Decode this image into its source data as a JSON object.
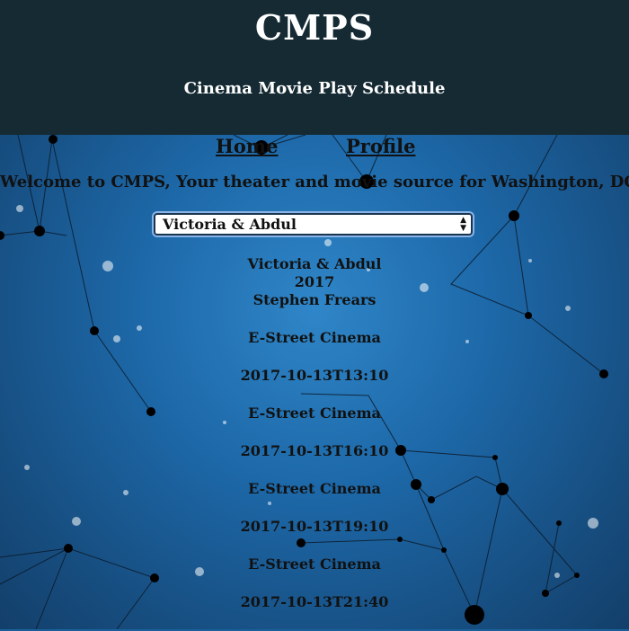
{
  "header": {
    "title": "CMPS",
    "subtitle": "Cinema Movie Play Schedule"
  },
  "nav": {
    "home": "Home",
    "profile": "Profile"
  },
  "welcome": "Welcome to CMPS, Your theater and movie source for Washington, DC!",
  "movie_select": {
    "selected": "Victoria & Abdul"
  },
  "movie": {
    "title": "Victoria & Abdul",
    "year": "2017",
    "director": "Stephen Frears"
  },
  "showings": [
    {
      "theater": "E-Street Cinema",
      "time": "2017-10-13T13:10"
    },
    {
      "theater": "E-Street Cinema",
      "time": "2017-10-13T16:10"
    },
    {
      "theater": "E-Street Cinema",
      "time": "2017-10-13T19:10"
    },
    {
      "theater": "E-Street Cinema",
      "time": "2017-10-13T21:40"
    }
  ],
  "colors": {
    "header_bg": "#152a33",
    "sky": "#1d68a8"
  }
}
